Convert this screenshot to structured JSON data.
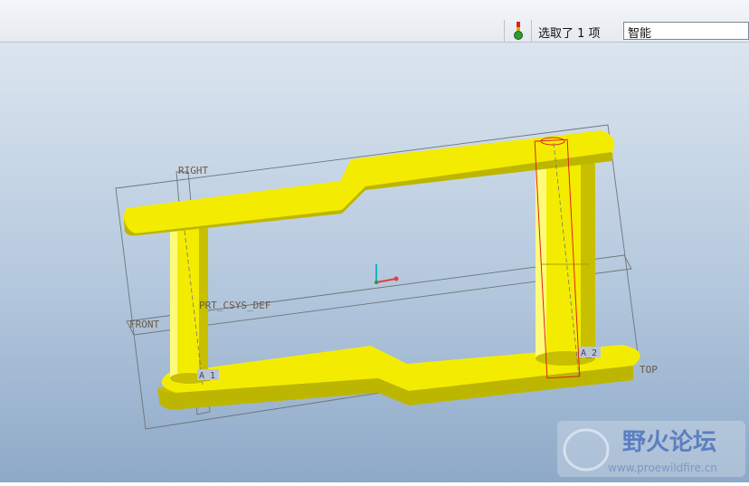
{
  "status": {
    "selection_text": "选取了 1 项",
    "filter_value": "智能"
  },
  "model": {
    "datums": {
      "right": "RIGHT",
      "front": "FRONT",
      "top": "TOP",
      "csys": "PRT_CSYS_DEF",
      "axis_1": "A_1",
      "axis_2": "A_2"
    },
    "part_color": "#f4ec00"
  },
  "watermark": {
    "title": "野火论坛",
    "url": "www.proewildfire.cn"
  }
}
